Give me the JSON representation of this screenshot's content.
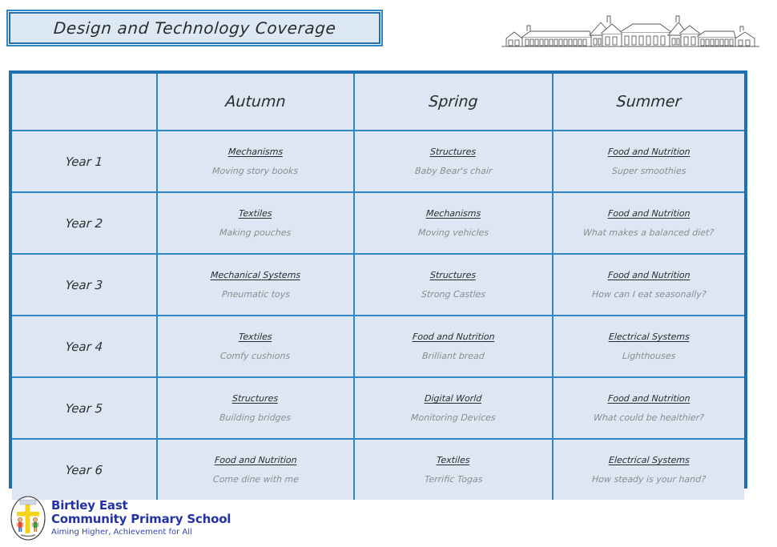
{
  "header": {
    "title": "Design and Technology Coverage",
    "illustration_name": "school-building-line-drawing"
  },
  "table": {
    "corner_label": "",
    "columns": [
      "Autumn",
      "Spring",
      "Summer"
    ],
    "rows": [
      {
        "year": "Year 1",
        "cells": [
          {
            "topic": "Mechanisms",
            "project": "Moving story books"
          },
          {
            "topic": "Structures",
            "project": "Baby Bear's chair"
          },
          {
            "topic": "Food and Nutrition",
            "project": "Super smoothies"
          }
        ]
      },
      {
        "year": "Year 2",
        "cells": [
          {
            "topic": "Textiles",
            "project": "Making pouches"
          },
          {
            "topic": "Mechanisms",
            "project": "Moving vehicles"
          },
          {
            "topic": "Food and Nutrition",
            "project": "What makes a balanced diet?"
          }
        ]
      },
      {
        "year": "Year 3",
        "cells": [
          {
            "topic": "Mechanical Systems",
            "project": "Pneumatic toys"
          },
          {
            "topic": "Structures",
            "project": "Strong Castles"
          },
          {
            "topic": "Food and Nutrition",
            "project": "How can I eat seasonally?"
          }
        ]
      },
      {
        "year": "Year 4",
        "cells": [
          {
            "topic": "Textiles",
            "project": "Comfy cushions"
          },
          {
            "topic": "Food and Nutrition",
            "project": "Brilliant bread"
          },
          {
            "topic": "Electrical Systems",
            "project": "Lighthouses"
          }
        ]
      },
      {
        "year": "Year 5",
        "cells": [
          {
            "topic": "Structures",
            "project": "Building bridges"
          },
          {
            "topic": "Digital World",
            "project": "Monitoring Devices"
          },
          {
            "topic": "Food and Nutrition",
            "project": "What could be healthier?"
          }
        ]
      },
      {
        "year": "Year 6",
        "cells": [
          {
            "topic": "Food and Nutrition",
            "project": "Come dine with me"
          },
          {
            "topic": "Textiles",
            "project": "Terrific Togas"
          },
          {
            "topic": "Electrical Systems",
            "project": "How steady is your hand?"
          }
        ]
      }
    ]
  },
  "footer": {
    "logo_line1": "Birtley East",
    "logo_line2": "Community Primary School",
    "tagline": "Aiming Higher, Achievement for All",
    "badge_name": "school-crest-icon"
  },
  "colors": {
    "outer_border": "#1f6fb2",
    "grid_line": "#2e87c4",
    "cell_fill": "#dce7f3",
    "title_fill": "#dde8f5",
    "topic_text": "#2b2b2b",
    "project_text": "#8c8c8c",
    "logo_blue": "#2332a8"
  }
}
